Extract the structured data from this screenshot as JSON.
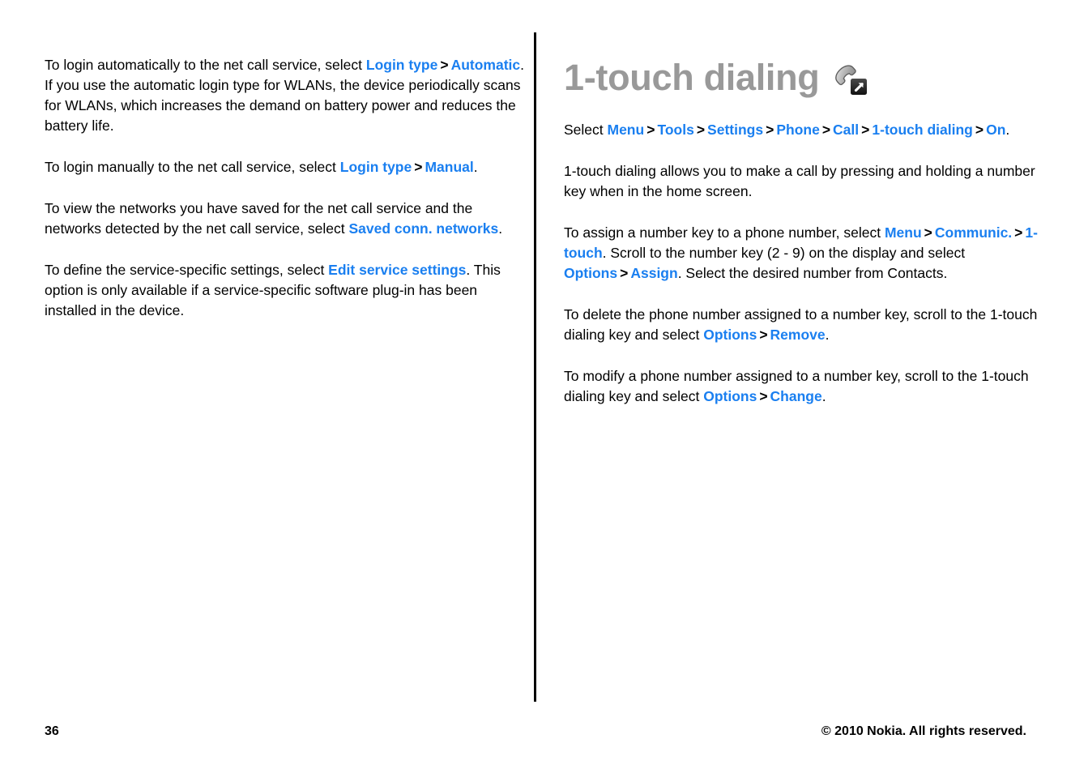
{
  "document": {
    "page_number": "36",
    "copyright": "© 2010 Nokia. All rights reserved.",
    "link_color": "#1a7ff0",
    "heading_color": "#999999",
    "body_color": "#000000"
  },
  "left_column": {
    "paragraphs": [
      {
        "id": "auto-login",
        "runs": [
          {
            "type": "text",
            "value": "To login automatically to the net call service, select "
          },
          {
            "type": "link",
            "value": "Login type"
          },
          {
            "type": "sep",
            "value": ">"
          },
          {
            "type": "link",
            "value": "Automatic"
          },
          {
            "type": "text",
            "value": ". If you use the automatic login type for WLANs, the device periodically scans for WLANs, which increases the demand on battery power and reduces the battery life."
          }
        ]
      },
      {
        "id": "manual-login",
        "runs": [
          {
            "type": "text",
            "value": "To login manually to the net call service, select "
          },
          {
            "type": "link",
            "value": "Login type"
          },
          {
            "type": "sep",
            "value": ">"
          },
          {
            "type": "link",
            "value": "Manual"
          },
          {
            "type": "text",
            "value": "."
          }
        ]
      },
      {
        "id": "saved-networks",
        "runs": [
          {
            "type": "text",
            "value": "To view the networks you have saved for the net call service and the networks detected by the net call service, select "
          },
          {
            "type": "link",
            "value": "Saved conn. networks"
          },
          {
            "type": "text",
            "value": "."
          }
        ]
      },
      {
        "id": "service-settings",
        "runs": [
          {
            "type": "text",
            "value": "To define the service-specific settings, select "
          },
          {
            "type": "link",
            "value": "Edit service settings"
          },
          {
            "type": "text",
            "value": ". This option is only available if a service-specific software plug-in has been installed in the device."
          }
        ]
      }
    ]
  },
  "right_column": {
    "heading": {
      "title": "1-touch dialing",
      "icon": "phone-handset-shortcut-icon"
    },
    "paragraphs": [
      {
        "id": "menu-path",
        "runs": [
          {
            "type": "text",
            "value": "Select "
          },
          {
            "type": "link",
            "value": "Menu"
          },
          {
            "type": "sep",
            "value": ">"
          },
          {
            "type": "link",
            "value": "Tools"
          },
          {
            "type": "sep",
            "value": ">"
          },
          {
            "type": "link",
            "value": "Settings"
          },
          {
            "type": "sep",
            "value": ">"
          },
          {
            "type": "link",
            "value": "Phone"
          },
          {
            "type": "sep",
            "value": ">"
          },
          {
            "type": "link",
            "value": "Call"
          },
          {
            "type": "sep",
            "value": ">"
          },
          {
            "type": "link",
            "value": "1-touch dialing"
          },
          {
            "type": "sep",
            "value": ">"
          },
          {
            "type": "link",
            "value": "On"
          },
          {
            "type": "text",
            "value": "."
          }
        ]
      },
      {
        "id": "description",
        "runs": [
          {
            "type": "text",
            "value": "1-touch dialing allows you to make a call by pressing and holding a number key when in the home screen."
          }
        ]
      },
      {
        "id": "assign",
        "runs": [
          {
            "type": "text",
            "value": "To assign a number key to a phone number, select "
          },
          {
            "type": "link",
            "value": "Menu"
          },
          {
            "type": "sep",
            "value": ">"
          },
          {
            "type": "link",
            "value": "Communic."
          },
          {
            "type": "sep",
            "value": ">"
          },
          {
            "type": "link",
            "value": "1-touch"
          },
          {
            "type": "text",
            "value": ". Scroll to the number key (2 - 9) on the display and select "
          },
          {
            "type": "link",
            "value": "Options"
          },
          {
            "type": "sep",
            "value": ">"
          },
          {
            "type": "link",
            "value": "Assign"
          },
          {
            "type": "text",
            "value": ". Select the desired number from Contacts."
          }
        ]
      },
      {
        "id": "delete",
        "runs": [
          {
            "type": "text",
            "value": "To delete the phone number assigned to a number key, scroll to the 1-touch dialing key and select "
          },
          {
            "type": "link",
            "value": "Options"
          },
          {
            "type": "sep",
            "value": ">"
          },
          {
            "type": "link",
            "value": "Remove"
          },
          {
            "type": "text",
            "value": "."
          }
        ]
      },
      {
        "id": "modify",
        "runs": [
          {
            "type": "text",
            "value": "To modify a phone number assigned to a number key, scroll to the 1-touch dialing key and select "
          },
          {
            "type": "link",
            "value": "Options"
          },
          {
            "type": "sep",
            "value": ">"
          },
          {
            "type": "link",
            "value": "Change"
          },
          {
            "type": "text",
            "value": "."
          }
        ]
      }
    ]
  }
}
